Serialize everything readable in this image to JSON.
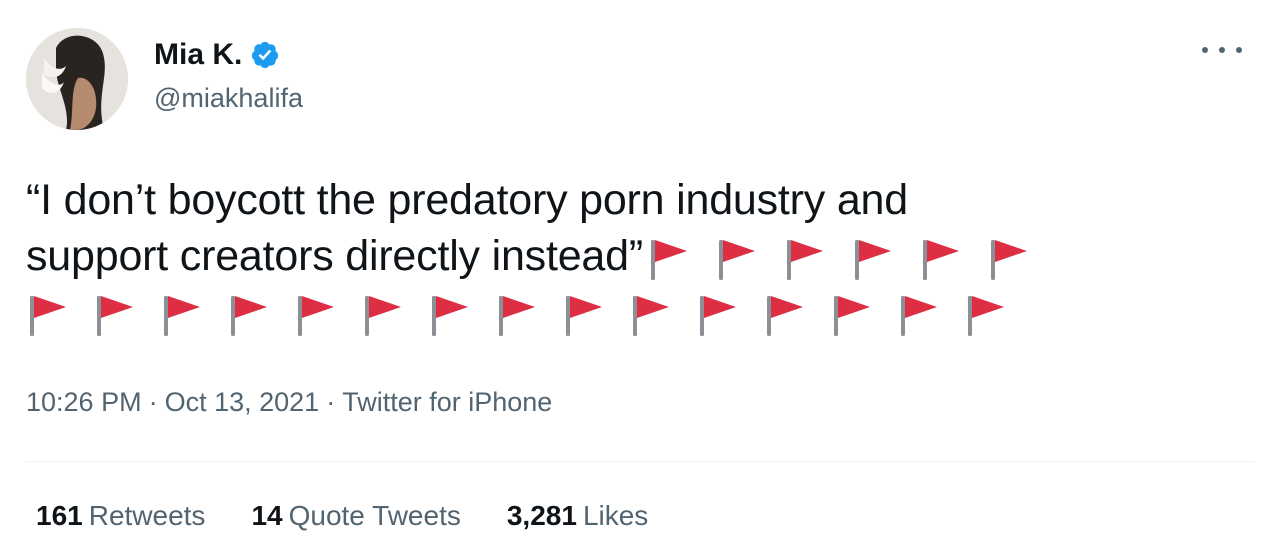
{
  "tweet": {
    "author": {
      "display_name": "Mia K.",
      "handle": "@miakhalifa",
      "verified": true,
      "avatar": "profile-photo"
    },
    "text_line1": "“I don’t boycott the predatory porn industry and",
    "text_line2": "support creators directly instead”",
    "flag_emoji": "red-flag-icon",
    "flags_line2_count": 6,
    "flags_line3_count": 15,
    "meta": {
      "time": "10:26 PM",
      "date": "Oct 13, 2021",
      "source": "Twitter for iPhone",
      "separator": "·"
    },
    "stats": {
      "retweets_count": "161",
      "retweets_label": "Retweets",
      "quote_count": "14",
      "quote_label": "Quote Tweets",
      "likes_count": "3,281",
      "likes_label": "Likes"
    }
  },
  "colors": {
    "text_primary": "#0f1419",
    "text_secondary": "#536471",
    "verified_blue": "#1d9bf0",
    "flag_red": "#dd2e44"
  }
}
